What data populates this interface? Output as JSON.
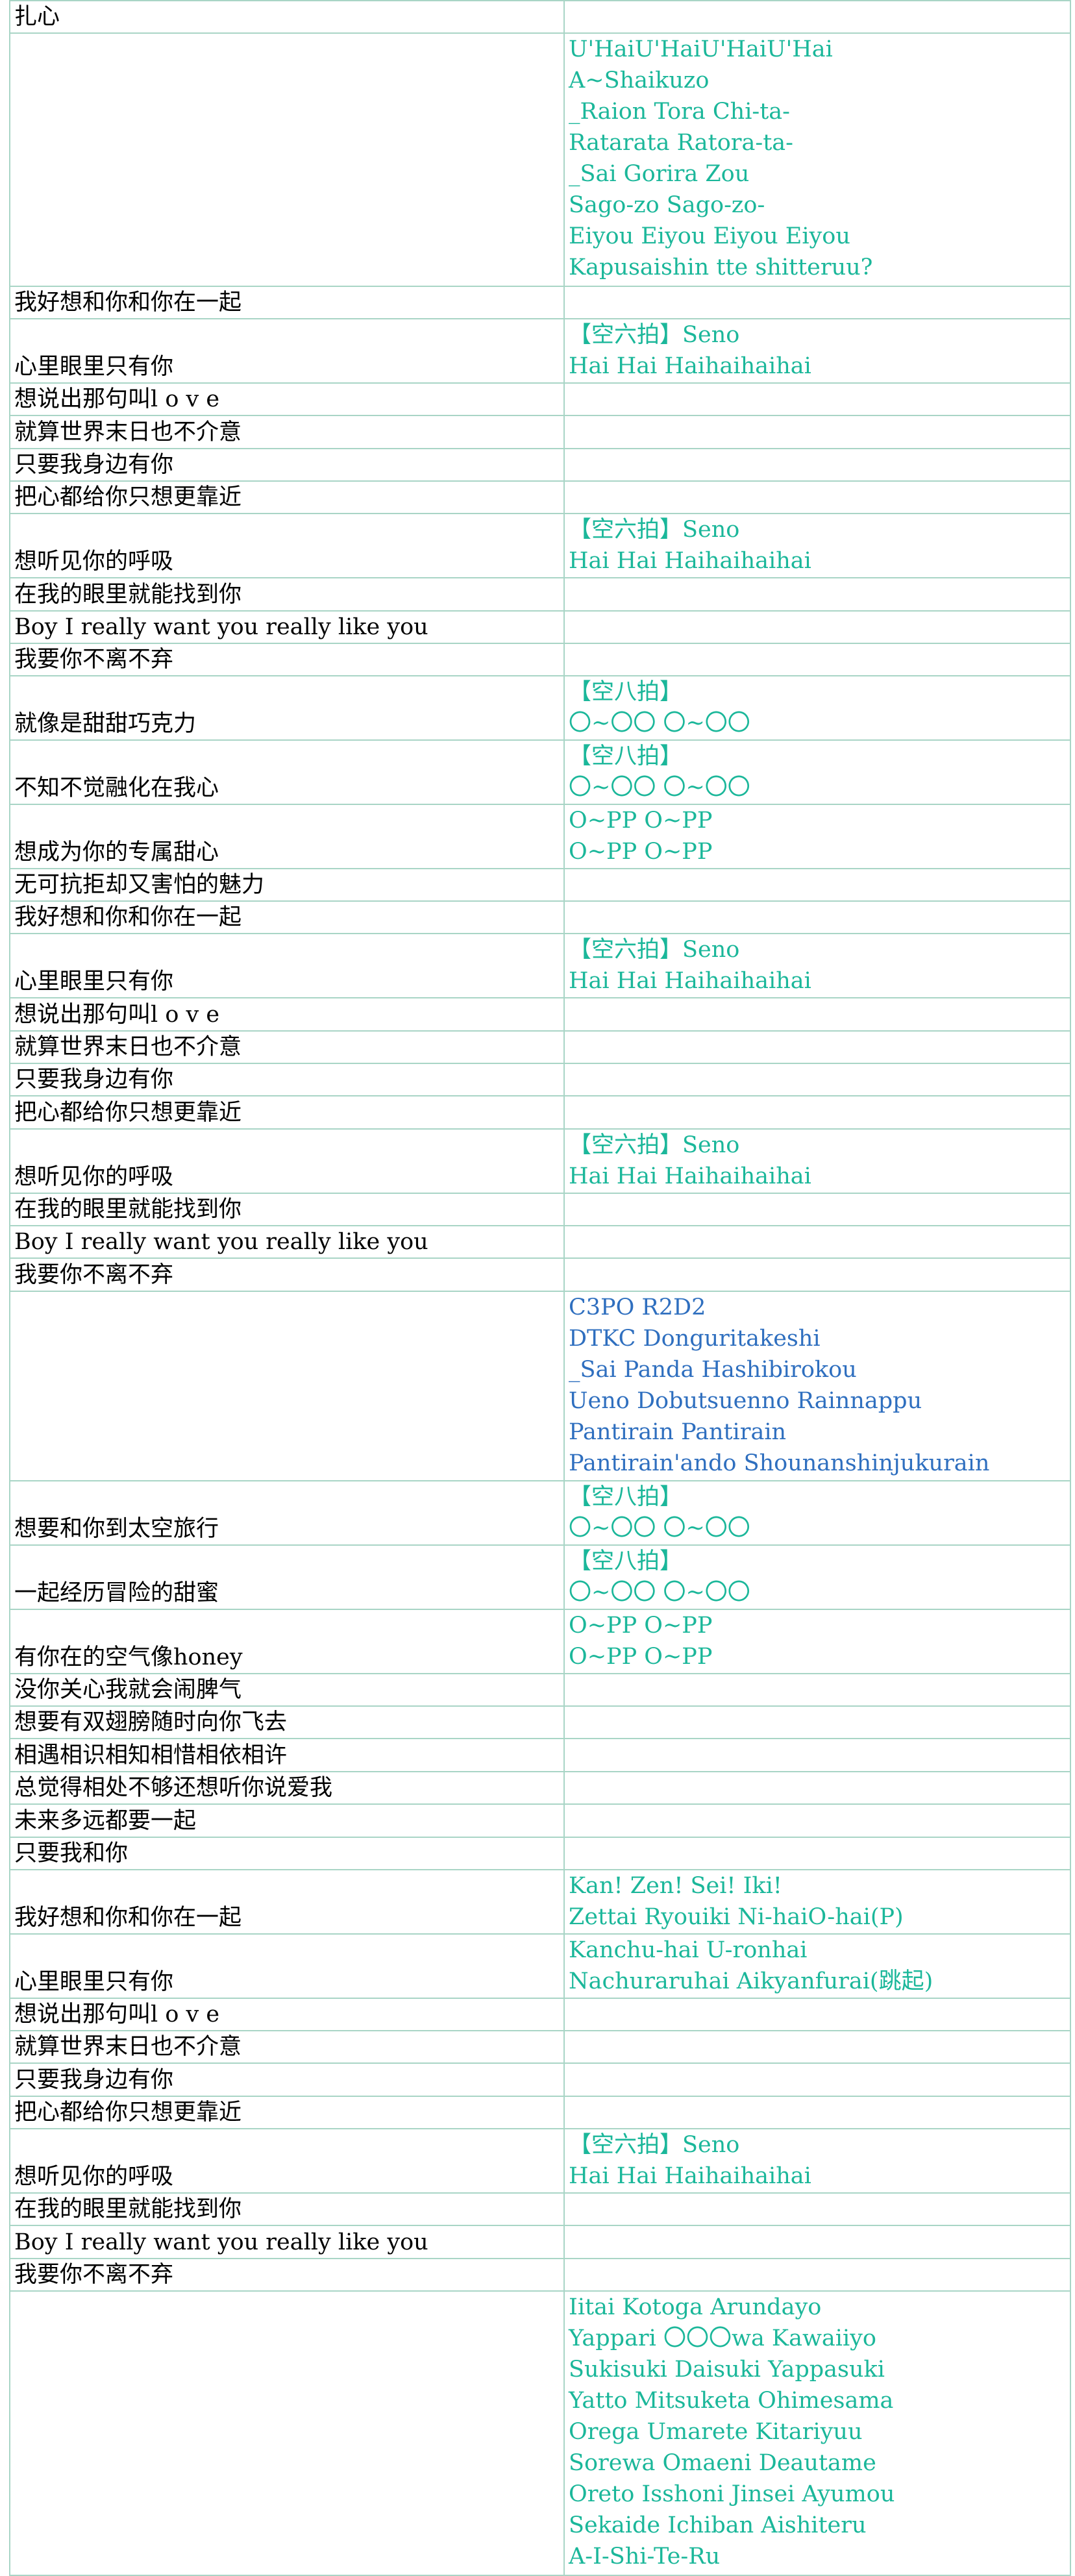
{
  "colors": {
    "lyric": "#000000",
    "call": "#1bb79a",
    "call_alt": "#2f6fbf",
    "grid": "#a9d5c6"
  },
  "rows": [
    {
      "lyric": "扎心",
      "calls": []
    },
    {
      "lyric": "",
      "calls": [
        "U'HaiU'HaiU'HaiU'Hai",
        "A~Shaikuzo",
        "_Raion Tora Chi-ta-",
        "Ratarata Ratora-ta-",
        "_Sai Gorira Zou",
        "Sago-zo Sago-zo-",
        "Eiyou Eiyou Eiyou Eiyou",
        "Kapusaishin tte shitteruu?"
      ]
    },
    {
      "lyric": "我好想和你和你在一起",
      "calls": []
    },
    {
      "lyric": "心里眼里只有你",
      "calls": [
        "【空六拍】Seno",
        "Hai Hai Haihaihaihai"
      ]
    },
    {
      "lyric": "想说出那句叫l o v e",
      "calls": []
    },
    {
      "lyric": "就算世界末日也不介意",
      "calls": []
    },
    {
      "lyric": "只要我身边有你",
      "calls": []
    },
    {
      "lyric": "把心都给你只想更靠近",
      "calls": []
    },
    {
      "lyric": "想听见你的呼吸",
      "calls": [
        "【空六拍】Seno",
        "Hai Hai Haihaihaihai"
      ]
    },
    {
      "lyric": "在我的眼里就能找到你",
      "calls": []
    },
    {
      "lyric": "Boy I really want you really like you",
      "calls": []
    },
    {
      "lyric": "我要你不离不弃",
      "calls": []
    },
    {
      "lyric": "就像是甜甜巧克力",
      "calls": [
        "【空八拍】",
        "〇~〇〇 〇~〇〇"
      ]
    },
    {
      "lyric": "不知不觉融化在我心",
      "calls": [
        "【空八拍】",
        "〇~〇〇 〇~〇〇"
      ]
    },
    {
      "lyric": "想成为你的专属甜心",
      "calls": [
        "O~PP O~PP",
        "O~PP O~PP"
      ]
    },
    {
      "lyric": "无可抗拒却又害怕的魅力",
      "calls": []
    },
    {
      "lyric": "我好想和你和你在一起",
      "calls": []
    },
    {
      "lyric": "心里眼里只有你",
      "calls": [
        "【空六拍】Seno",
        "Hai Hai Haihaihaihai"
      ]
    },
    {
      "lyric": "想说出那句叫l o v e",
      "calls": []
    },
    {
      "lyric": "就算世界末日也不介意",
      "calls": []
    },
    {
      "lyric": "只要我身边有你",
      "calls": []
    },
    {
      "lyric": "把心都给你只想更靠近",
      "calls": []
    },
    {
      "lyric": "想听见你的呼吸",
      "calls": [
        "【空六拍】Seno",
        "Hai Hai Haihaihaihai"
      ]
    },
    {
      "lyric": "在我的眼里就能找到你",
      "calls": []
    },
    {
      "lyric": "Boy I really want you really like you",
      "calls": []
    },
    {
      "lyric": "我要你不离不弃",
      "calls": []
    },
    {
      "lyric": "",
      "calls": [
        "C3PO R2D2",
        "DTKC Donguritakeshi",
        "_Sai Panda Hashibirokou",
        "Ueno Dobutsuenno Rainnappu",
        "Pantirain Pantirain",
        "Pantirain'ando Shounanshinjukurain"
      ],
      "alt": true
    },
    {
      "lyric": "想要和你到太空旅行",
      "calls": [
        "【空八拍】",
        "〇~〇〇 〇~〇〇"
      ]
    },
    {
      "lyric": "一起经历冒险的甜蜜",
      "calls": [
        "【空八拍】",
        "〇~〇〇 〇~〇〇"
      ]
    },
    {
      "lyric": "有你在的空气像honey",
      "calls": [
        "O~PP O~PP",
        "O~PP O~PP"
      ]
    },
    {
      "lyric": "没你关心我就会闹脾气",
      "calls": []
    },
    {
      "lyric": "想要有双翅膀随时向你飞去",
      "calls": []
    },
    {
      "lyric": "相遇相识相知相惜相依相许",
      "calls": []
    },
    {
      "lyric": "总觉得相处不够还想听你说爱我",
      "calls": []
    },
    {
      "lyric": "未来多远都要一起",
      "calls": []
    },
    {
      "lyric": "只要我和你",
      "calls": []
    },
    {
      "lyric": "我好想和你和你在一起",
      "calls": [
        "Kan! Zen! Sei! Iki!",
        "Zettai Ryouiki Ni-haiO-hai(P)"
      ]
    },
    {
      "lyric": "心里眼里只有你",
      "calls": [
        "Kanchu-hai U-ronhai",
        "Nachuraruhai Aikyanfurai(跳起)"
      ]
    },
    {
      "lyric": "想说出那句叫l o v e",
      "calls": []
    },
    {
      "lyric": "就算世界末日也不介意",
      "calls": []
    },
    {
      "lyric": "只要我身边有你",
      "calls": []
    },
    {
      "lyric": "把心都给你只想更靠近",
      "calls": []
    },
    {
      "lyric": "想听见你的呼吸",
      "calls": [
        "【空六拍】Seno",
        "Hai Hai Haihaihaihai"
      ]
    },
    {
      "lyric": "在我的眼里就能找到你",
      "calls": []
    },
    {
      "lyric": "Boy I really want you really like you",
      "calls": []
    },
    {
      "lyric": "我要你不离不弃",
      "calls": []
    },
    {
      "lyric": "",
      "calls": [
        "Iitai Kotoga Arundayo",
        "Yappari 〇〇〇wa Kawaiiyo",
        "Sukisuki Daisuki Yappasuki",
        "Yatto Mitsuketa Ohimesama",
        "Orega Umarete Kitariyuu",
        "Sorewa Omaeni Deautame",
        "Oreto Isshoni Jinsei Ayumou",
        "Sekaide Ichiban Aishiteru",
        "A-I-Shi-Te-Ru"
      ]
    }
  ]
}
